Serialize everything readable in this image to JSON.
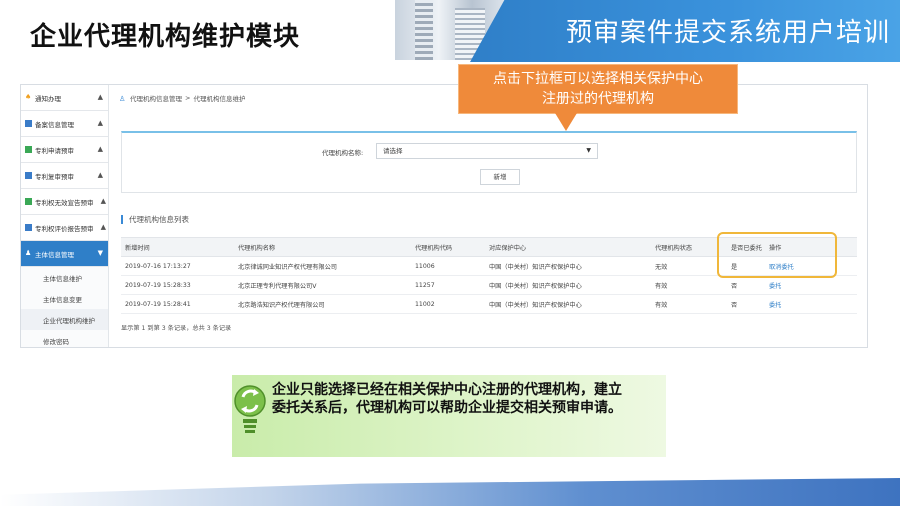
{
  "slide": {
    "title": "企业代理机构维护模块",
    "banner": "预审案件提交系统用户培训"
  },
  "callout": {
    "line1": "点击下拉框可以选择相关保护中心",
    "line2": "注册过的代理机构"
  },
  "sidebar": {
    "items": [
      {
        "label": "通知办理",
        "chevron": "▲"
      },
      {
        "label": "备案信息管理",
        "chevron": "▲"
      },
      {
        "label": "专利申请预审",
        "chevron": "▲"
      },
      {
        "label": "专利复审预审",
        "chevron": "▲"
      },
      {
        "label": "专利权无效宣告预审",
        "chevron": "▲"
      },
      {
        "label": "专利权评价报告预审",
        "chevron": "▲"
      },
      {
        "label": "主体信息管理",
        "chevron": "▼"
      }
    ],
    "sub_items": [
      "主体信息维护",
      "主体信息变更",
      "企业代理机构维护",
      "修改密码"
    ]
  },
  "breadcrumb": {
    "part1": "代理机构信息管理",
    "separator": ">",
    "part2": "代理机构信息维护"
  },
  "filter": {
    "label": "代理机构名称:",
    "select_value": "请选择",
    "add_button": "新增"
  },
  "list": {
    "title": "代理机构信息列表",
    "columns": [
      "新增时间",
      "代理机构名称",
      "代理机构代码",
      "对应保护中心",
      "代理机构状态",
      "是否已委托",
      "操作"
    ],
    "rows": [
      [
        "2019-07-16 17:13:27",
        "北京律诚同业知识产权代理有限公司",
        "11006",
        "中国（中关村）知识产权保护中心",
        "无效",
        "是",
        "取消委托"
      ],
      [
        "2019-07-19 15:28:33",
        "北京正理专利代理有限公司V",
        "11257",
        "中国（中关村）知识产权保护中心",
        "有效",
        "否",
        "委托"
      ],
      [
        "2019-07-19 15:28:41",
        "北京路浩知识产权代理有限公司",
        "11002",
        "中国（中关村）知识产权保护中心",
        "有效",
        "否",
        "委托"
      ]
    ],
    "pager": "显示第 1 到第 3 条记录，总共 3 条记录"
  },
  "tip": {
    "line1": "企业只能选择已经在相关保护中心注册的代理机构，建立",
    "line2": "委托关系后，代理机构可以帮助企业提交相关预审申请。"
  },
  "colors": {
    "accent": "#2f7fc8",
    "callout": "#ef8a3a",
    "highlight": "#f0b73a",
    "tip_green": "#c9ecaa"
  }
}
